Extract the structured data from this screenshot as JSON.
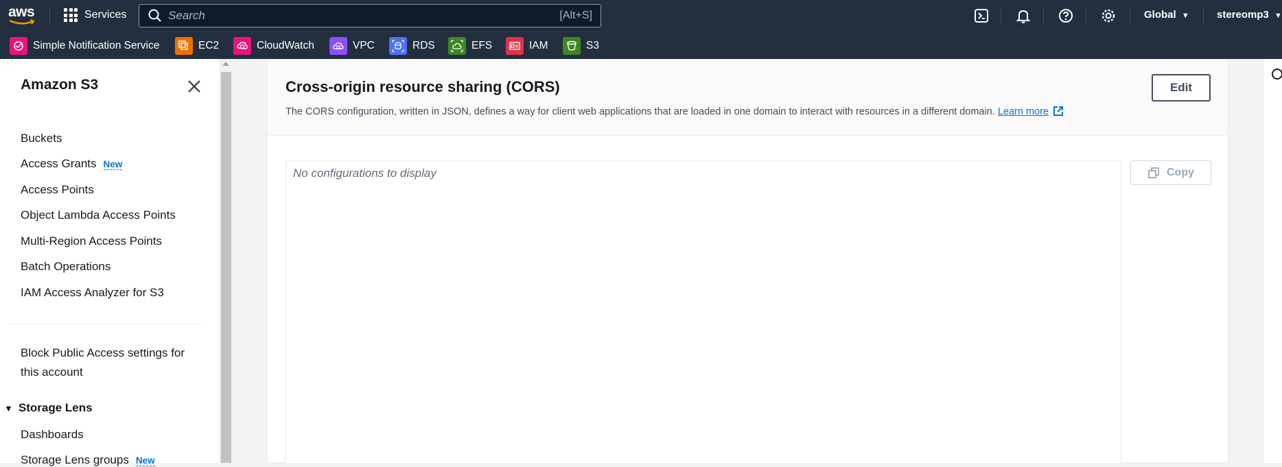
{
  "topnav": {
    "logo_text": "aws",
    "services_label": "Services",
    "search_placeholder": "Search",
    "search_shortcut": "[Alt+S]",
    "region_label": "Global",
    "user_label": "stereomp3",
    "icons": [
      "cloudshell-icon",
      "notifications-icon",
      "help-icon",
      "settings-icon"
    ]
  },
  "favorites": [
    {
      "label": "Simple Notification Service",
      "color": "#e7157b"
    },
    {
      "label": "EC2",
      "color": "#ed7100"
    },
    {
      "label": "CloudWatch",
      "color": "#e7157b"
    },
    {
      "label": "VPC",
      "color": "#8c4fff"
    },
    {
      "label": "RDS",
      "color": "#4d72f3"
    },
    {
      "label": "EFS",
      "color": "#3f8624"
    },
    {
      "label": "IAM",
      "color": "#dd344c"
    },
    {
      "label": "S3",
      "color": "#3f8624"
    }
  ],
  "sidebar": {
    "title": "Amazon S3",
    "items": [
      {
        "label": "Buckets"
      },
      {
        "label": "Access Grants",
        "badge": "New"
      },
      {
        "label": "Access Points"
      },
      {
        "label": "Object Lambda Access Points"
      },
      {
        "label": "Multi-Region Access Points"
      },
      {
        "label": "Batch Operations"
      },
      {
        "label": "IAM Access Analyzer for S3"
      }
    ],
    "block_public_line1": "Block Public Access settings for",
    "block_public_line2": "this account",
    "storage_lens": {
      "title": "Storage Lens",
      "items": [
        {
          "label": "Dashboards"
        },
        {
          "label": "Storage Lens groups",
          "badge": "New"
        }
      ]
    }
  },
  "main": {
    "title": "Cross-origin resource sharing (CORS)",
    "description": "The CORS configuration, written in JSON, defines a way for client web applications that are loaded in one domain to interact with resources in a different domain.",
    "learn_more": "Learn more",
    "edit_label": "Edit",
    "empty_text": "No configurations to display",
    "copy_label": "Copy"
  },
  "colors": {
    "nav_bg": "#232f3e",
    "link": "#0972d3"
  }
}
